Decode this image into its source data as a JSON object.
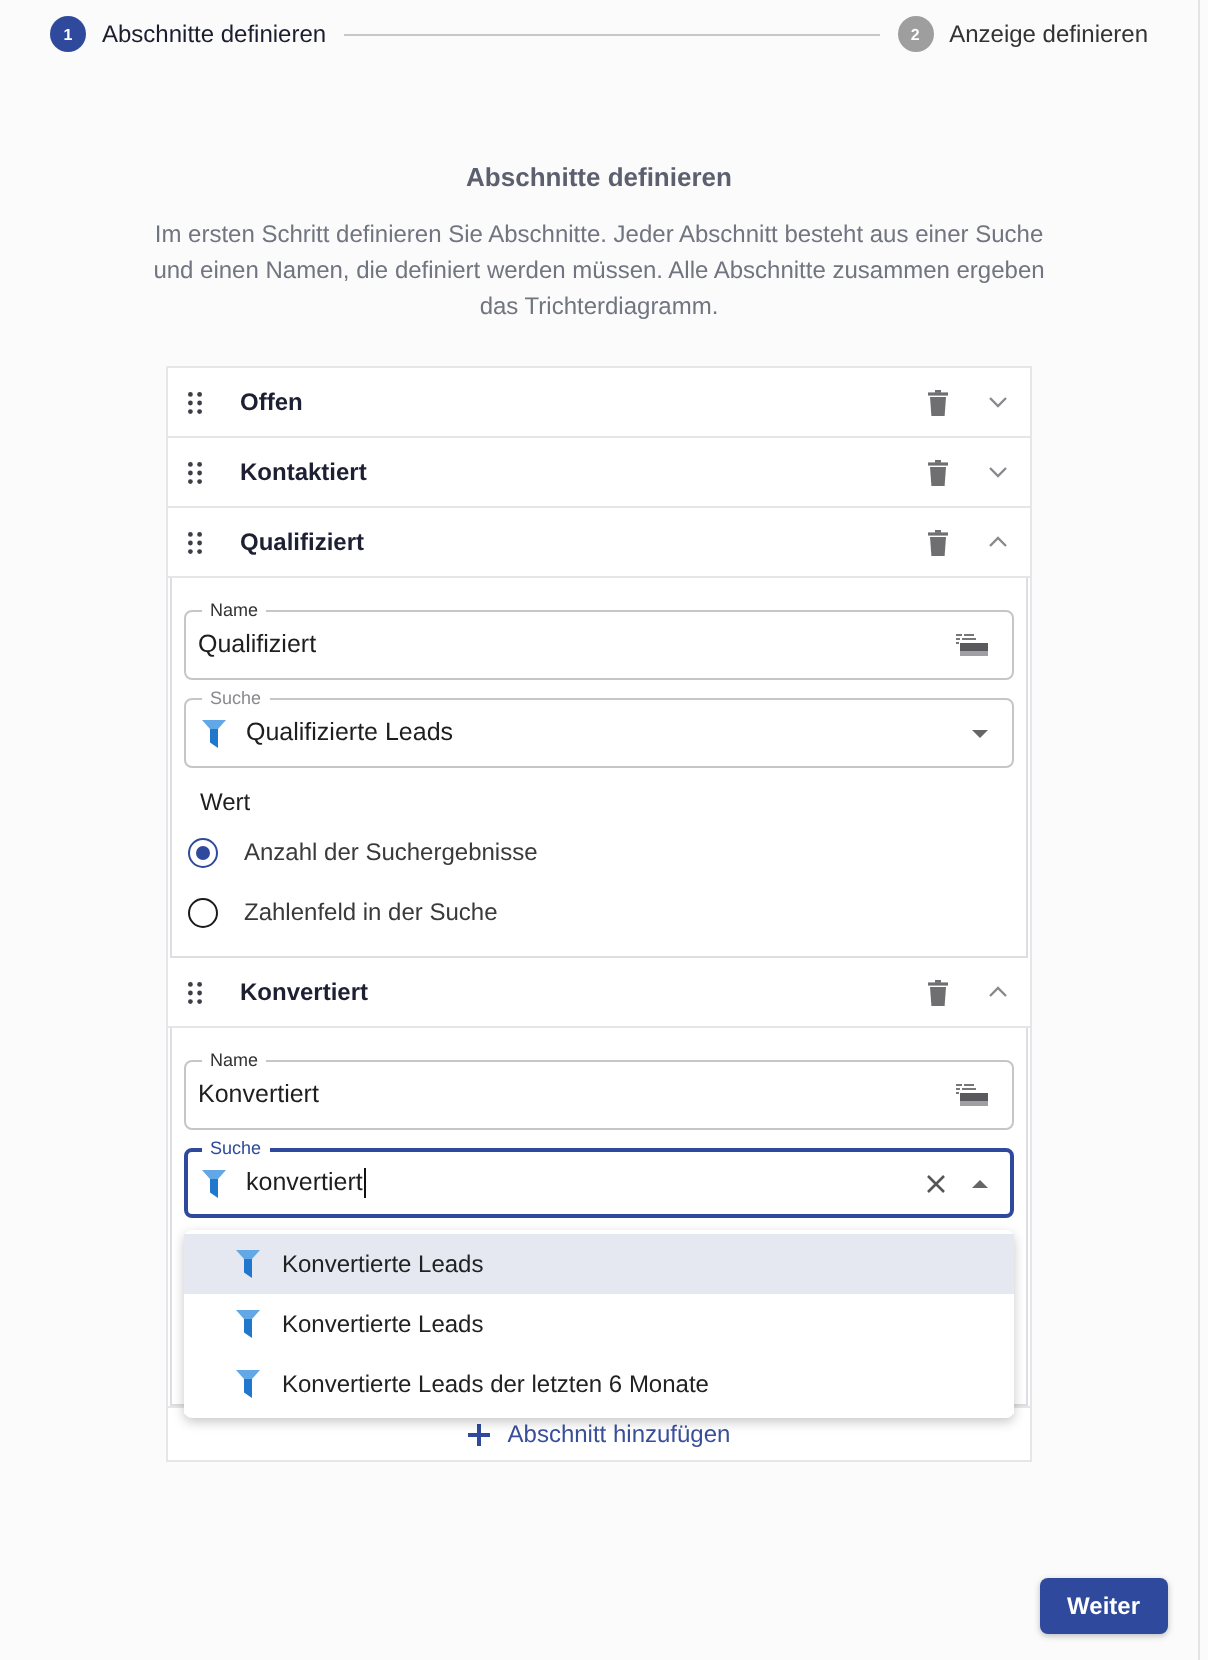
{
  "stepper": {
    "steps": [
      {
        "number": "1",
        "label": "Abschnitte definieren",
        "selected": true
      },
      {
        "number": "2",
        "label": "Anzeige definieren",
        "selected": false
      }
    ]
  },
  "intro": {
    "title": "Abschnitte definieren",
    "description": "Im ersten Schritt definieren Sie Abschnitte. Jeder Abschnitt besteht aus einer Suche und einen Namen, die definiert werden müssen. Alle Abschnitte zusammen ergeben das Trichterdiagramm."
  },
  "sections": [
    {
      "title": "Offen",
      "expanded": false
    },
    {
      "title": "Kontaktiert",
      "expanded": false
    },
    {
      "title": "Qualifiziert",
      "expanded": true,
      "name_field": {
        "label": "Name",
        "value": "Qualifiziert"
      },
      "search_field": {
        "label": "Suche",
        "value": "Qualifizierte Leads",
        "focused": false,
        "open": false
      },
      "value_group": {
        "label": "Wert",
        "options": [
          {
            "label": "Anzahl der Suchergebnisse",
            "selected": true
          },
          {
            "label": "Zahlenfeld in der Suche",
            "selected": false
          }
        ]
      }
    },
    {
      "title": "Konvertiert",
      "expanded": true,
      "name_field": {
        "label": "Name",
        "value": "Konvertiert"
      },
      "search_field": {
        "label": "Suche",
        "value": "konvertiert",
        "focused": true,
        "open": true,
        "options": [
          {
            "label": "Konvertierte Leads",
            "selected": true
          },
          {
            "label": "Konvertierte Leads",
            "selected": false
          },
          {
            "label": "Konvertierte Leads der letzten 6 Monate",
            "selected": false
          }
        ]
      }
    }
  ],
  "add_button": {
    "label": "Abschnitt hinzufügen"
  },
  "next_button": {
    "label": "Weiter"
  }
}
